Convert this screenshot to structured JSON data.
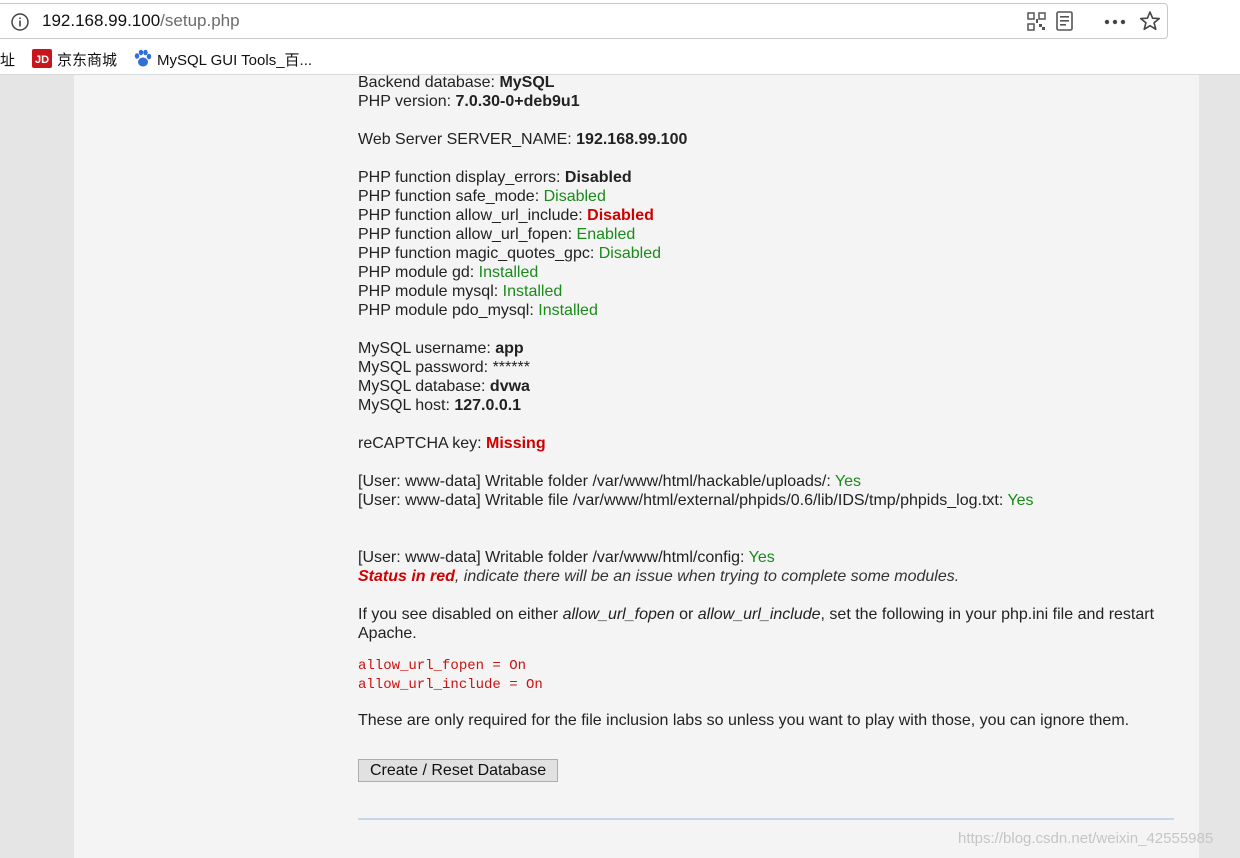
{
  "browser": {
    "url_host": "192.168.99.100",
    "url_path": "/setup.php",
    "bookmarks": [
      {
        "label": "址",
        "icon": "folder-icon"
      },
      {
        "label": "京东商城",
        "icon": "jd-logo-icon"
      },
      {
        "label": "MySQL GUI Tools_百...",
        "icon": "baidu-paw-icon"
      }
    ]
  },
  "setup": {
    "backend_label": "Backend database: ",
    "backend_value": "MySQL",
    "php_version_label": "PHP version: ",
    "php_version_value": "7.0.30-0+deb9u1",
    "server_name_label": "Web Server SERVER_NAME: ",
    "server_name_value": "192.168.99.100",
    "display_errors_label": "PHP function display_errors: ",
    "display_errors_value": "Disabled",
    "safe_mode_label": "PHP function safe_mode: ",
    "safe_mode_value": "Disabled",
    "allow_url_include_label": "PHP function allow_url_include: ",
    "allow_url_include_value": "Disabled",
    "allow_url_fopen_label": "PHP function allow_url_fopen: ",
    "allow_url_fopen_value": "Enabled",
    "magic_quotes_label": "PHP function magic_quotes_gpc: ",
    "magic_quotes_value": "Disabled",
    "gd_label": "PHP module gd: ",
    "gd_value": "Installed",
    "mysql_label": "PHP module mysql: ",
    "mysql_value": "Installed",
    "pdo_label": "PHP module pdo_mysql: ",
    "pdo_value": "Installed",
    "db_user_label": "MySQL username: ",
    "db_user_value": "app",
    "db_pass_label": "MySQL password: ",
    "db_pass_value": "******",
    "db_name_label": "MySQL database: ",
    "db_name_value": "dvwa",
    "db_host_label": "MySQL host: ",
    "db_host_value": "127.0.0.1",
    "recaptcha_label": "reCAPTCHA key: ",
    "recaptcha_value": "Missing",
    "uploads_label": "[User: www-data] Writable folder /var/www/html/hackable/uploads/: ",
    "uploads_value": "Yes",
    "phpids_label": "[User: www-data] Writable file /var/www/html/external/phpids/0.6/lib/IDS/tmp/phpids_log.txt: ",
    "phpids_value": "Yes",
    "config_label": "[User: www-data] Writable folder /var/www/html/config: ",
    "config_value": "Yes",
    "status_red": "Status in red",
    "status_note": ", indicate there will be an issue when trying to complete some modules.",
    "ini_text_1": "If you see disabled on either ",
    "ini_em_1": "allow_url_fopen",
    "ini_text_2": " or ",
    "ini_em_2": "allow_url_include",
    "ini_text_3": ", set the following in your php.ini file and restart Apache.",
    "code_line_1": "allow_url_fopen = On",
    "code_line_2": "allow_url_include = On",
    "inclusion_note": "These are only required for the file inclusion labs so unless you want to play with those, you can ignore them.",
    "button_label": "Create / Reset Database"
  },
  "watermark": "https://blog.csdn.net/weixin_42555985",
  "colors": {
    "ok": "#1a8a1a",
    "error": "#d10000",
    "code": "#cc1111"
  }
}
